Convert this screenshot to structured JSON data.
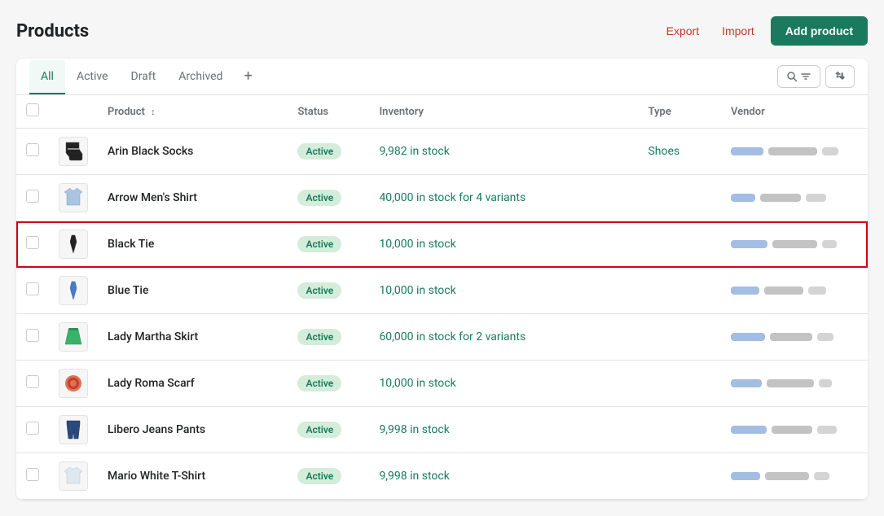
{
  "page": {
    "title": "Products",
    "header": {
      "export_label": "Export",
      "import_label": "Import",
      "add_product_label": "Add product"
    },
    "tabs": [
      {
        "id": "all",
        "label": "All",
        "active": true
      },
      {
        "id": "active",
        "label": "Active",
        "active": false
      },
      {
        "id": "draft",
        "label": "Draft",
        "active": false
      },
      {
        "id": "archived",
        "label": "Archived",
        "active": false
      }
    ],
    "table": {
      "columns": [
        {
          "id": "check",
          "label": ""
        },
        {
          "id": "img",
          "label": ""
        },
        {
          "id": "product",
          "label": "Product",
          "sortable": true
        },
        {
          "id": "status",
          "label": "Status"
        },
        {
          "id": "inventory",
          "label": "Inventory"
        },
        {
          "id": "type",
          "label": "Type"
        },
        {
          "id": "vendor",
          "label": "Vendor"
        }
      ],
      "rows": [
        {
          "id": 1,
          "name": "Arin Black Socks",
          "status": "Active",
          "inventory": "9,982 in stock",
          "inventory_link": true,
          "type": "Shoes",
          "type_link": true,
          "highlighted": false,
          "icon": "socks"
        },
        {
          "id": 2,
          "name": "Arrow Men's Shirt",
          "status": "Active",
          "inventory": "40,000 in stock for 4 variants",
          "inventory_link": true,
          "type": "",
          "type_link": false,
          "highlighted": false,
          "icon": "shirt"
        },
        {
          "id": 3,
          "name": "Black Tie",
          "status": "Active",
          "inventory": "10,000 in stock",
          "inventory_link": true,
          "type": "",
          "type_link": false,
          "highlighted": true,
          "icon": "tie-black"
        },
        {
          "id": 4,
          "name": "Blue Tie",
          "status": "Active",
          "inventory": "10,000 in stock",
          "inventory_link": true,
          "type": "",
          "type_link": false,
          "highlighted": false,
          "icon": "tie-blue"
        },
        {
          "id": 5,
          "name": "Lady Martha Skirt",
          "status": "Active",
          "inventory": "60,000 in stock for 2 variants",
          "inventory_link": true,
          "type": "",
          "type_link": false,
          "highlighted": false,
          "icon": "skirt"
        },
        {
          "id": 6,
          "name": "Lady Roma Scarf",
          "status": "Active",
          "inventory": "10,000 in stock",
          "inventory_link": true,
          "type": "",
          "type_link": false,
          "highlighted": false,
          "icon": "scarf"
        },
        {
          "id": 7,
          "name": "Libero Jeans Pants",
          "status": "Active",
          "inventory": "9,998 in stock",
          "inventory_link": true,
          "type": "",
          "type_link": false,
          "highlighted": false,
          "icon": "pants"
        },
        {
          "id": 8,
          "name": "Mario White T-Shirt",
          "status": "Active",
          "inventory": "9,998 in stock",
          "inventory_link": true,
          "type": "",
          "type_link": false,
          "highlighted": false,
          "icon": "tshirt"
        }
      ]
    }
  }
}
